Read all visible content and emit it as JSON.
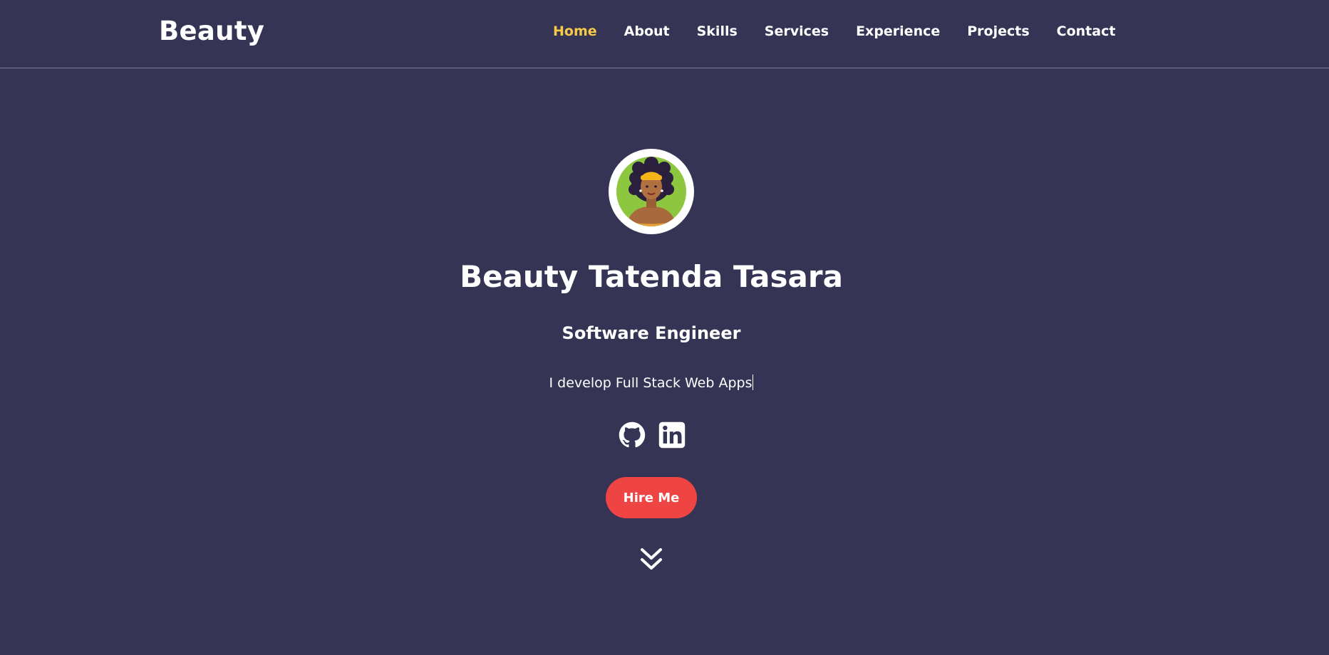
{
  "brand": "Beauty",
  "nav": {
    "items": [
      {
        "label": "Home",
        "active": true
      },
      {
        "label": "About",
        "active": false
      },
      {
        "label": "Skills",
        "active": false
      },
      {
        "label": "Services",
        "active": false
      },
      {
        "label": "Experience",
        "active": false
      },
      {
        "label": "Projects",
        "active": false
      },
      {
        "label": "Contact",
        "active": false
      }
    ]
  },
  "hero": {
    "name": "Beauty Tatenda Tasara",
    "role": "Software Engineer",
    "tagline": "I develop Full Stack Web Apps",
    "hire_label": "Hire Me",
    "socials": [
      {
        "icon": "github-icon"
      },
      {
        "icon": "linkedin-icon"
      }
    ]
  },
  "colors": {
    "background": "#353455",
    "accent": "#f7c948",
    "button": "#ef4444",
    "text": "#ffffff"
  }
}
